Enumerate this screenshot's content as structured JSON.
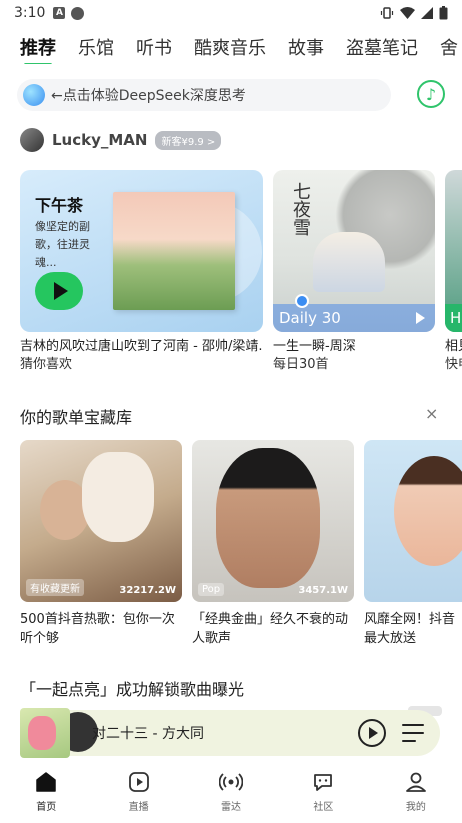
{
  "status": {
    "time": "3:10",
    "a_icon": "A"
  },
  "tabs": [
    {
      "label": "推荐",
      "active": true
    },
    {
      "label": "乐馆"
    },
    {
      "label": "听书"
    },
    {
      "label": "酷爽音乐"
    },
    {
      "label": "故事"
    },
    {
      "label": "盗墓笔记"
    },
    {
      "label": "舍"
    }
  ],
  "search": {
    "text": "←点击体验DeepSeek深度思考"
  },
  "user": {
    "name": "Lucky_MAN",
    "badge": "新客¥9.9 >"
  },
  "row1": {
    "big_card": {
      "title": "下午茶",
      "subtitle": "像坚定的副歌，往进灵魂..."
    },
    "big_caption": "吉林的风吹过唐山吹到了河南 - 邵帅/梁靖...",
    "big_caption_sub": "猜你喜欢",
    "daily_card": {
      "poem": "七夜雪",
      "bar_label": "Daily 30"
    },
    "daily_caption": "一生一瞬-周深",
    "daily_caption_sub": "每日30首",
    "edge_card": {
      "bar_label": "H"
    },
    "edge_caption": "相見",
    "edge_caption_sub": "快申"
  },
  "section_playlists": {
    "title": "你的歌单宝藏库",
    "close": "×"
  },
  "playlists": [
    {
      "tag": "有收藏更新",
      "count": "32217.2W",
      "caption": "500首抖音热歌：包你一次听个够"
    },
    {
      "tag": "Pop",
      "count": "3457.1W",
      "caption": "「经典金曲」经久不衰的动人歌声"
    },
    {
      "tag": "",
      "count": "",
      "caption": "风靡全网！抖音最大放送"
    }
  ],
  "section_unlock": {
    "title": "「一起点亮」成功解锁歌曲曝光"
  },
  "player": {
    "song": "对二十三 - 方大同"
  },
  "nav": [
    {
      "label": "首页",
      "active": true
    },
    {
      "label": "直播"
    },
    {
      "label": "雷达"
    },
    {
      "label": "社区"
    },
    {
      "label": "我的"
    }
  ],
  "colors": {
    "accent": "#2fc46b",
    "play_green": "#25c65f",
    "daily_blue": "#3b8df2"
  }
}
